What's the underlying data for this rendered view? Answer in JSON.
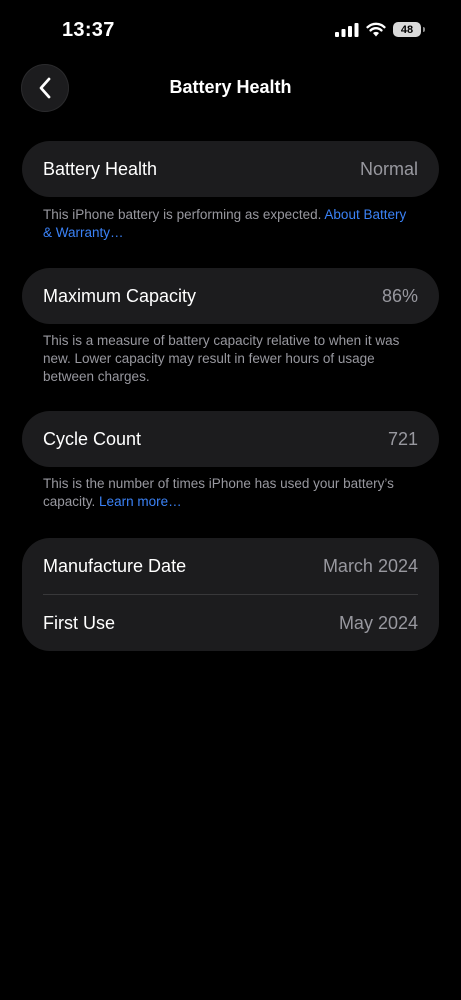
{
  "status_bar": {
    "time": "13:37",
    "battery_level": "48"
  },
  "nav": {
    "title": "Battery Health"
  },
  "battery_health": {
    "label": "Battery Health",
    "value": "Normal",
    "footnote": "This iPhone battery is performing as expected.",
    "link": "About Battery & Warranty…"
  },
  "maximum_capacity": {
    "label": "Maximum Capacity",
    "value": "86%",
    "footnote": "This is a measure of battery capacity relative to when it was new. Lower capacity may result in fewer hours of usage between charges."
  },
  "cycle_count": {
    "label": "Cycle Count",
    "value": "721",
    "footnote": "This is the number of times iPhone has used your battery’s capacity.",
    "link": "Learn more…"
  },
  "dates": {
    "manufacture_label": "Manufacture Date",
    "manufacture_value": "March 2024",
    "first_use_label": "First Use",
    "first_use_value": "May 2024"
  },
  "colors": {
    "background": "#000000",
    "card": "#1c1c1e",
    "secondary_text": "#98989f",
    "link": "#3b82f6"
  }
}
